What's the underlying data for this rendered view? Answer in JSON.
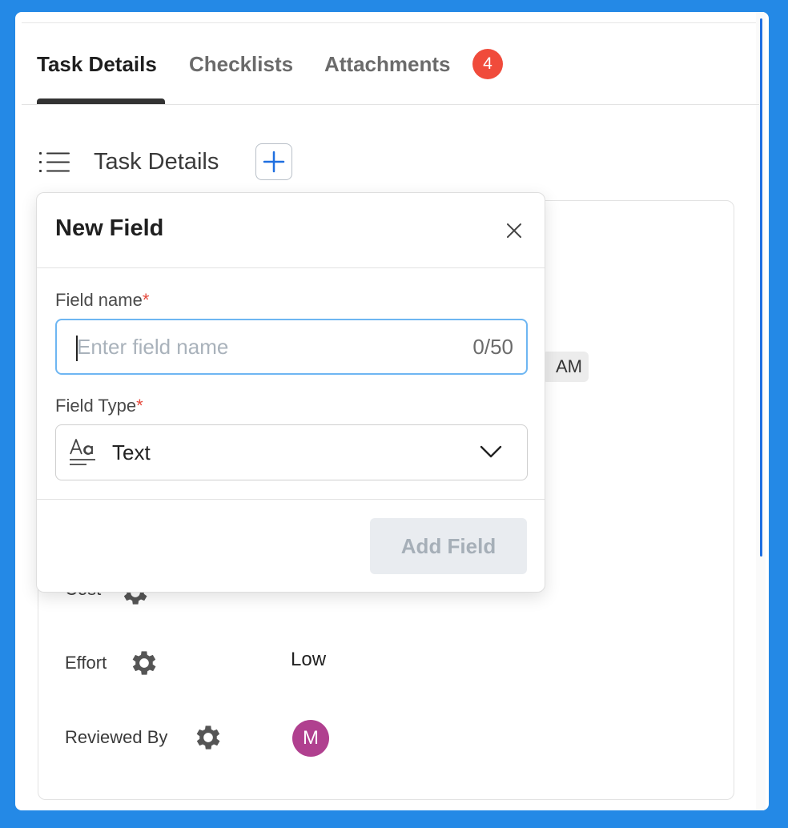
{
  "tabs": {
    "items": [
      {
        "label": "Task Details",
        "active": true
      },
      {
        "label": "Checklists",
        "active": false
      },
      {
        "label": "Attachments",
        "active": false
      }
    ],
    "attachments_count": "4"
  },
  "section": {
    "title": "Task Details",
    "icons": {
      "list": "list-icon",
      "add": "plus-icon"
    }
  },
  "details": {
    "time_chip": "AM",
    "rows": [
      {
        "label": "Cost",
        "value": "",
        "icon": "gear-icon"
      },
      {
        "label": "Effort",
        "value": "Low",
        "icon": "gear-icon"
      },
      {
        "label": "Reviewed By",
        "value": "M",
        "icon": "gear-icon"
      }
    ],
    "avatar_color": "#b0408f"
  },
  "popup": {
    "title": "New Field",
    "field_name_label": "Field name",
    "required_mark": "*",
    "field_name_placeholder": "Enter field name",
    "field_name_value": "",
    "field_name_counter": "0/50",
    "field_type_label": "Field Type",
    "field_type_value": "Text",
    "field_type_icon": "text-format-icon",
    "add_button": "Add Field",
    "add_button_disabled": true
  },
  "colors": {
    "background": "#2489e6",
    "badge": "#f04b3b",
    "input_focus": "#6eb6f2",
    "required": "#e5483b",
    "add_icon": "#1f6fe0"
  }
}
